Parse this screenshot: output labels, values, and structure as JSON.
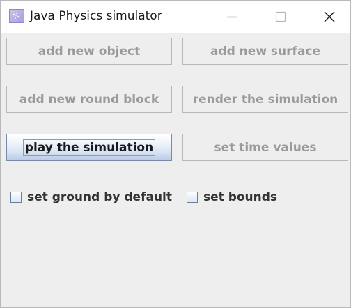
{
  "window": {
    "title": "Java Physics simulator",
    "icon": "java-app-icon",
    "controls": [
      "minimize-icon",
      "maximize-icon",
      "close-icon"
    ]
  },
  "buttons": {
    "add_object": "add new object",
    "add_surface": "add new surface",
    "add_round_block": "add new round block",
    "render": "render the simulation",
    "play": "play the simulation",
    "set_time": "set time values"
  },
  "checkboxes": {
    "ground": {
      "label": "set ground by default",
      "checked": false
    },
    "bounds": {
      "label": "set bounds",
      "checked": false
    }
  },
  "colors": {
    "background": "#eeeeee",
    "disabled_text": "#9a9a9a",
    "active_button_gradient_bottom": "#b9cbe6"
  }
}
